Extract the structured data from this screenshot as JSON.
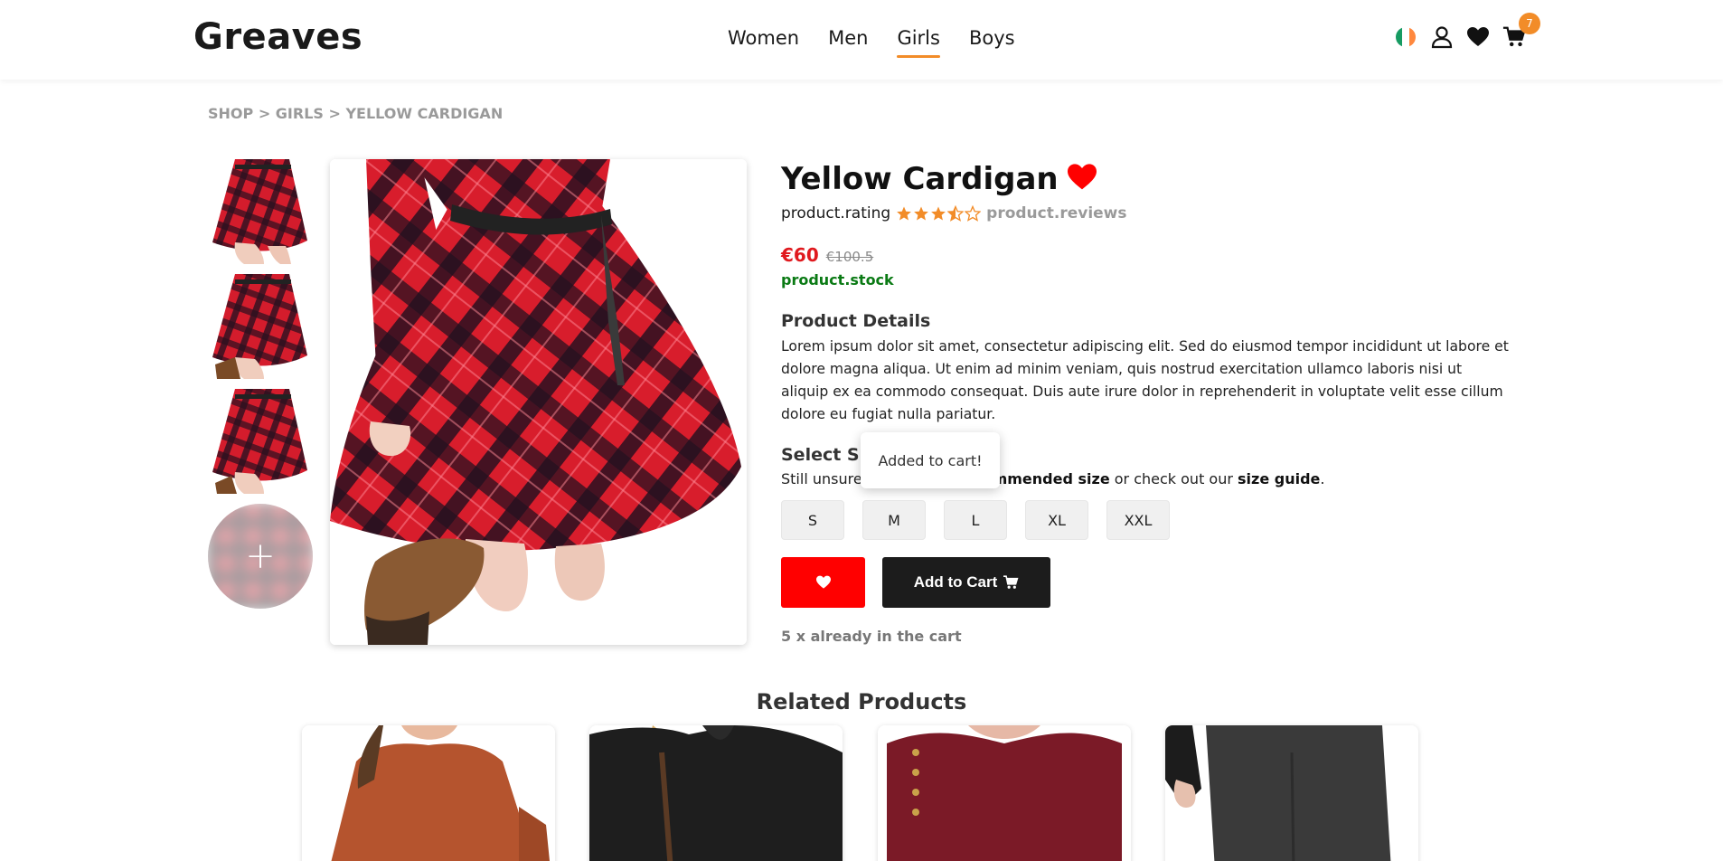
{
  "brand": "Greaves",
  "nav": [
    "Women",
    "Men",
    "Girls",
    "Boys"
  ],
  "nav_active": "Girls",
  "cart_count": "7",
  "breadcrumb": "SHOP > GIRLS > YELLOW CARDIGAN",
  "product": {
    "title": "Yellow Cardigan",
    "rating_label": "product.rating",
    "rating_stars": 3.5,
    "reviews_label": "product.reviews",
    "price": "€60",
    "old_price": "€100.5",
    "stock": "product.stock",
    "details_title": "Product Details",
    "details_text": "Lorem ipsum dolor sit amet, consectetur adipiscing elit. Sed do eiusmod tempor incididunt ut labore et dolore magna aliqua. Ut enim ad minim veniam, quis nostrud exercitation ullamco laboris nisi ut aliquip ex ea commodo consequat. Duis aute irure dolor in reprehenderit in voluptate velit esse cillum dolore eu fugiat nulla pariatur.",
    "select_size_title": "Select Size",
    "size_hint_prefix": "Still unsure? ",
    "size_hint_find": "Find your recommended size",
    "size_hint_mid": " or check out our ",
    "size_hint_guide": "size guide",
    "size_hint_end": ".",
    "sizes": [
      "S",
      "M",
      "L",
      "XL",
      "XXL"
    ],
    "add_to_cart_label": "Add to Cart",
    "in_cart_text": "5 x already in the cart"
  },
  "toast": "Added to cart!",
  "thumbnails_more": "+",
  "related_title": "Related Products",
  "colors": {
    "accent": "#f28c28",
    "price": "#e0191e",
    "stock": "#0a7a14",
    "favorite": "#ff0000",
    "dark_button": "#1c1c1c"
  },
  "icons": {
    "flag": "ireland-flag-icon",
    "account": "user-icon",
    "wishlist": "heart-icon",
    "cart": "cart-icon"
  }
}
